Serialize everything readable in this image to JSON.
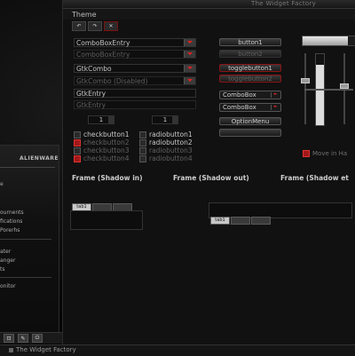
{
  "window": {
    "title": "The Widget Factory",
    "menu_label": "Theme"
  },
  "toolbar": {
    "icons": [
      "undo-icon",
      "redo-icon",
      "close-icon"
    ]
  },
  "entries": {
    "combo_box_entry": "ComboBoxEntry",
    "combo_box_entry_disabled": "ComboBoxEntry",
    "gtk_combo": "GtkCombo",
    "gtk_combo_disabled": "GtkCombo (Disabled)",
    "gtk_entry": "GtkEntry",
    "gtk_entry_disabled": "GtkEntry"
  },
  "spinners": {
    "left_value": "1",
    "right_value": "1"
  },
  "checkbuttons": [
    "checkbutton1",
    "checkbutton2",
    "checkbutton3",
    "checkbutton4"
  ],
  "radiobuttons": [
    "radiobutton1",
    "radiobutton2",
    "radiobutton3",
    "radiobutton4"
  ],
  "buttons": {
    "button1": "button1",
    "button2": "button2",
    "togglebutton1": "togglebutton1",
    "togglebutton2": "togglebutton2",
    "combobox1": "ComboBox",
    "combobox2": "ComboBox",
    "option_menu": "OptionMenu"
  },
  "right_panel": {
    "progress_fraction": 0.85,
    "move_in_handle": "Move in Ha"
  },
  "frames": {
    "shadow_in": "Frame (Shadow in)",
    "shadow_out": "Frame (Shadow out)",
    "shadow_etched": "Frame (Shadow et"
  },
  "tabs": {
    "tab1": "tab1",
    "tab2": "",
    "tab3": ""
  },
  "start_menu": {
    "brand": "ALIENWARE",
    "items": [
      "e",
      "ournents",
      "fications",
      "Porerhs",
      "ater",
      "anger",
      "ts",
      "onitor"
    ]
  },
  "statusbar": {
    "text": "The Widget Factory"
  },
  "colors": {
    "accent": "#a01818",
    "background": "#111111",
    "text": "#c8c8c8"
  }
}
